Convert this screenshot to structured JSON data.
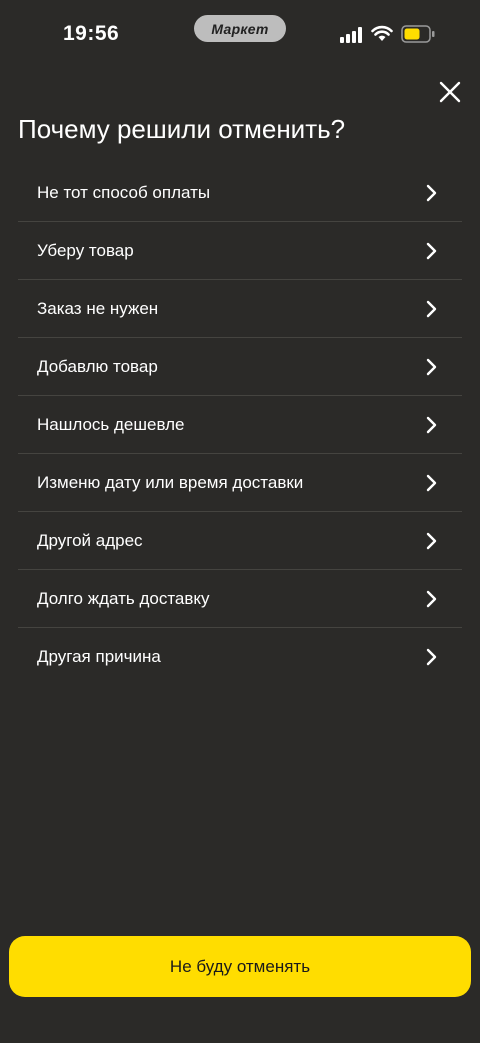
{
  "status_bar": {
    "time": "19:56",
    "app_name": "Маркет"
  },
  "header": {
    "title": "Почему решили отменить?"
  },
  "reasons": [
    {
      "label": "Не тот способ оплаты"
    },
    {
      "label": "Уберу товар"
    },
    {
      "label": "Заказ не нужен"
    },
    {
      "label": "Добавлю товар"
    },
    {
      "label": "Нашлось дешевле"
    },
    {
      "label": "Изменю дату или время доставки"
    },
    {
      "label": "Другой адрес"
    },
    {
      "label": "Долго ждать доставку"
    },
    {
      "label": "Другая причина"
    }
  ],
  "footer": {
    "keep_button_label": "Не буду отменять"
  },
  "colors": {
    "background": "#2b2a28",
    "accent": "#ffdd00",
    "divider": "#454440",
    "battery_fill": "#ffdd00"
  },
  "icons": {
    "close": "close-icon",
    "chevron": "chevron-right-icon",
    "signal": "cellular-signal-icon",
    "wifi": "wifi-icon",
    "battery": "battery-icon"
  }
}
